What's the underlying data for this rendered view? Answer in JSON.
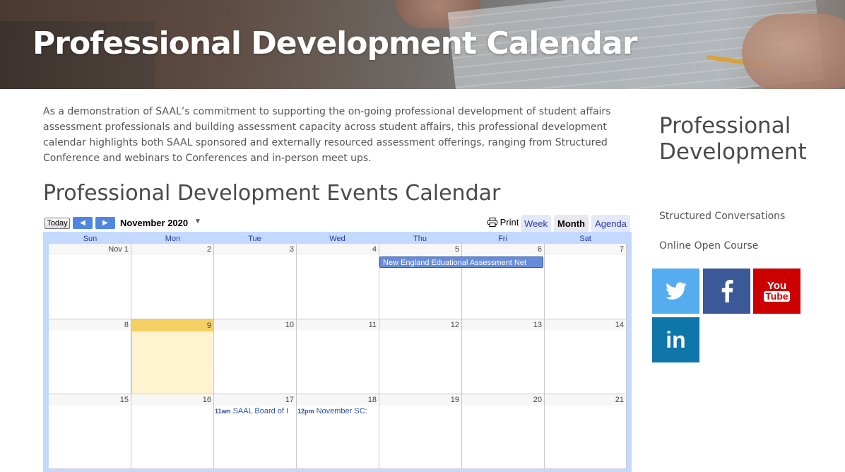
{
  "hero": {
    "title": "Professional Development Calendar"
  },
  "intro": "As a demonstration of SAAL’s commitment to supporting the on-going professional development of student affairs assessment professionals and building assessment capacity across student affairs, this professional development calendar highlights both SAAL sponsored and externally resourced assessment offerings, ranging from Structured Conference and webinars to Conferences and in-person meet ups.",
  "calendar_heading": "Professional Development Events Calendar",
  "calendar": {
    "today_label": "Today",
    "prev_icon": "left-arrow-icon",
    "next_icon": "right-arrow-icon",
    "month_label": "November 2020",
    "print_label": "Print",
    "tabs": [
      {
        "label": "Week",
        "active": false
      },
      {
        "label": "Month",
        "active": true
      },
      {
        "label": "Agenda",
        "active": false
      }
    ],
    "day_headers": [
      "Sun",
      "Mon",
      "Tue",
      "Wed",
      "Thu",
      "Fri",
      "Sat"
    ],
    "weeks": [
      [
        "Nov 1",
        "2",
        "3",
        "4",
        "5",
        "6",
        "7"
      ],
      [
        "8",
        "9",
        "10",
        "11",
        "12",
        "13",
        "14"
      ],
      [
        "15",
        "16",
        "17",
        "18",
        "19",
        "20",
        "21"
      ]
    ],
    "today_day": "9",
    "events": [
      {
        "title": "New England Eduational Assessment Net",
        "time": ""
      },
      {
        "title": "SAAL Board of I",
        "time": "11am"
      },
      {
        "title": "November SC:",
        "time": "12pm"
      }
    ],
    "colors": {
      "event_bar": "#668cd9",
      "today": "#fff4cf",
      "header": "#c3d9ff"
    }
  },
  "sidebar": {
    "title": "Professional Development",
    "links": [
      "Structured Conversations",
      "Online Open Course"
    ],
    "social": [
      {
        "name": "twitter",
        "icon": "twitter-icon",
        "color": "#55acee"
      },
      {
        "name": "facebook",
        "icon": "facebook-icon",
        "color": "#3b5998"
      },
      {
        "name": "youtube",
        "icon": "youtube-icon",
        "color": "#cc0000",
        "text_top": "You",
        "text_bottom": "Tube"
      },
      {
        "name": "linkedin",
        "icon": "linkedin-icon",
        "color": "#0e76a8",
        "text": "in"
      }
    ]
  }
}
